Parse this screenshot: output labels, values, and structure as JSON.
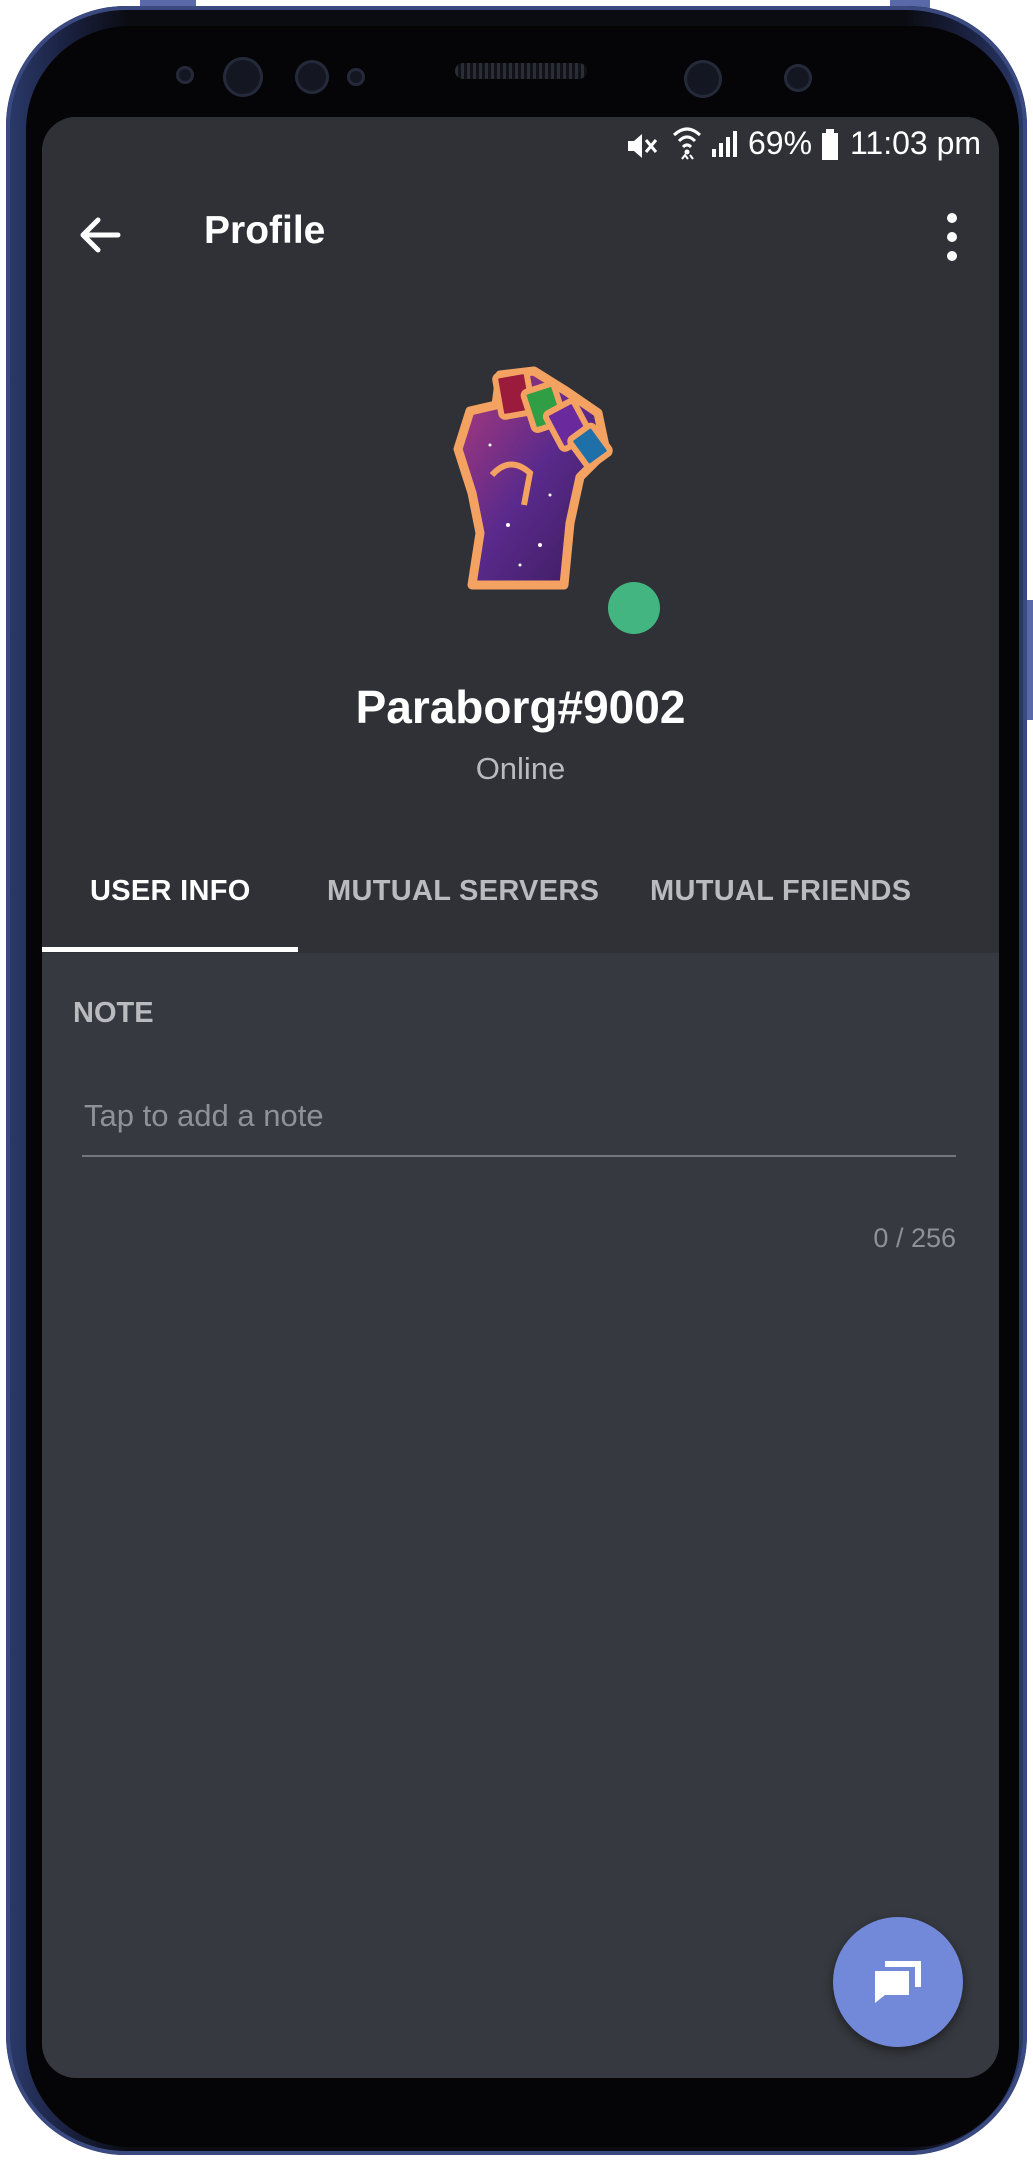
{
  "status_bar": {
    "battery": "69%",
    "time": "11:03 pm",
    "icons": [
      "mute-icon",
      "wifi-icon",
      "signal-icon",
      "battery-icon"
    ]
  },
  "toolbar": {
    "title": "Profile",
    "back_icon": "arrow-left-icon",
    "menu_icon": "more-vertical-icon"
  },
  "profile": {
    "username": "Paraborg#9002",
    "presence": "Online",
    "presence_color": "#43b581"
  },
  "tabs": [
    {
      "label": "USER INFO",
      "active": true
    },
    {
      "label": "MUTUAL SERVERS",
      "active": false
    },
    {
      "label": "MUTUAL FRIENDS",
      "active": false
    }
  ],
  "note": {
    "label": "NOTE",
    "placeholder": "Tap to add a note",
    "value": "",
    "counter": "0 / 256"
  },
  "fab": {
    "icon": "message-bubbles-icon",
    "color": "#7289da"
  },
  "colors": {
    "header_bg": "#2f3136",
    "content_bg": "#36393f",
    "accent": "#7289da"
  }
}
